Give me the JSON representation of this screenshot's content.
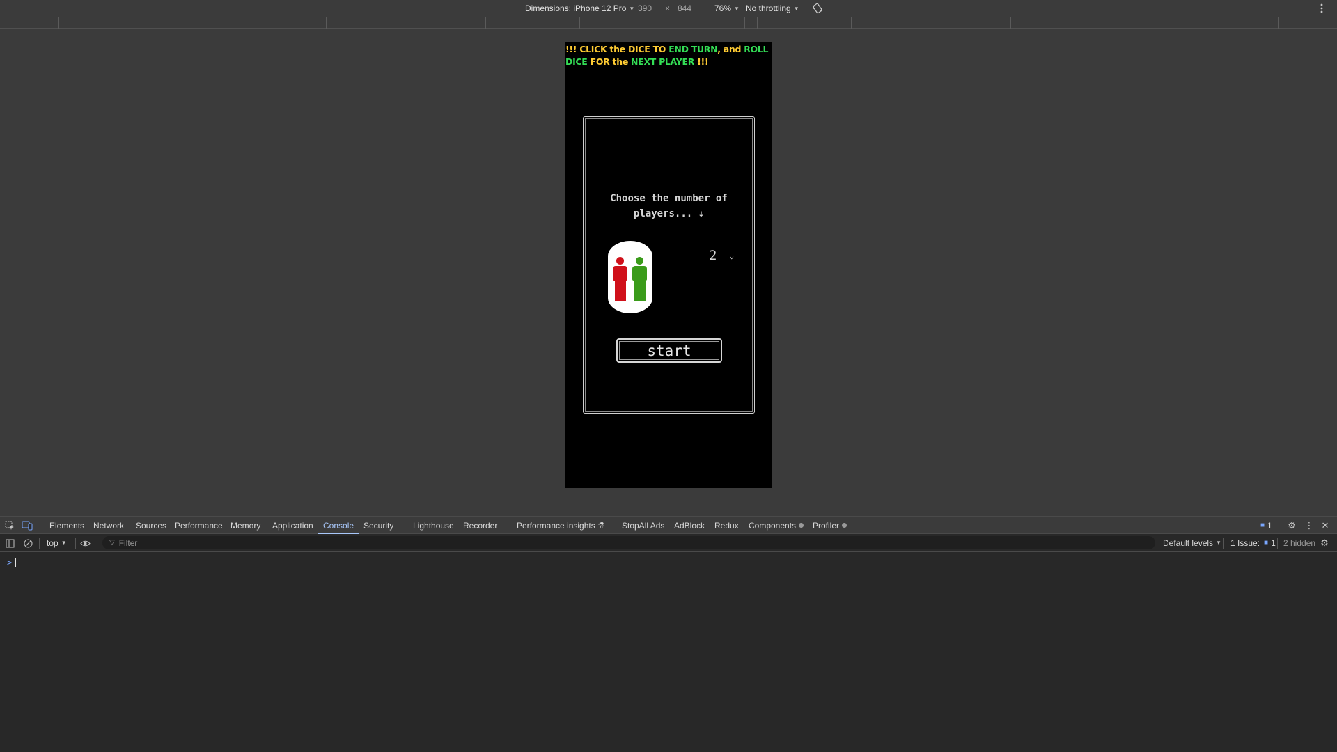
{
  "device_toolbar": {
    "dimensions_label": "Dimensions: iPhone 12 Pro",
    "width": "390",
    "times": "×",
    "height": "844",
    "zoom": "76%",
    "throttling": "No throttling",
    "rotate_icon": "rotate-icon",
    "more_icon": "kebab-menu-icon"
  },
  "page": {
    "banner": {
      "p1": "!!! CLICK the ",
      "p2": "DICE",
      "p3": " TO ",
      "p4": "END TURN",
      "p5": ", and ",
      "p6": "ROLL DICE",
      "p7": " FOR the ",
      "p8": "NEXT PLAYER",
      "p9": " !!!"
    },
    "prompt_line1": "Choose the number of",
    "prompt_line2": "players... ↓",
    "player_colors": [
      "#d0101a",
      "#3a9b1a"
    ],
    "player_count_selected": "2",
    "start_label": "start"
  },
  "devtools": {
    "tabs": [
      "Elements",
      "Network",
      "Sources",
      "Performance",
      "Memory",
      "Application",
      "Console",
      "Security",
      "Lighthouse",
      "Recorder",
      "Performance insights",
      "StopAll Ads",
      "AdBlock",
      "Redux",
      "Components",
      "Profiler"
    ],
    "active_tab": "Console",
    "issues_count_top": "1",
    "context": "top",
    "filter_placeholder": "Filter",
    "default_levels": "Default levels",
    "issue_label": "1 Issue:",
    "issue_count": "1",
    "hidden_label": "2 hidden",
    "prompt_symbol": ">"
  },
  "colors": {
    "banner_yellow": "#ffcc33",
    "banner_green": "#33dd55",
    "devtools_accent": "#a8c7fa"
  }
}
